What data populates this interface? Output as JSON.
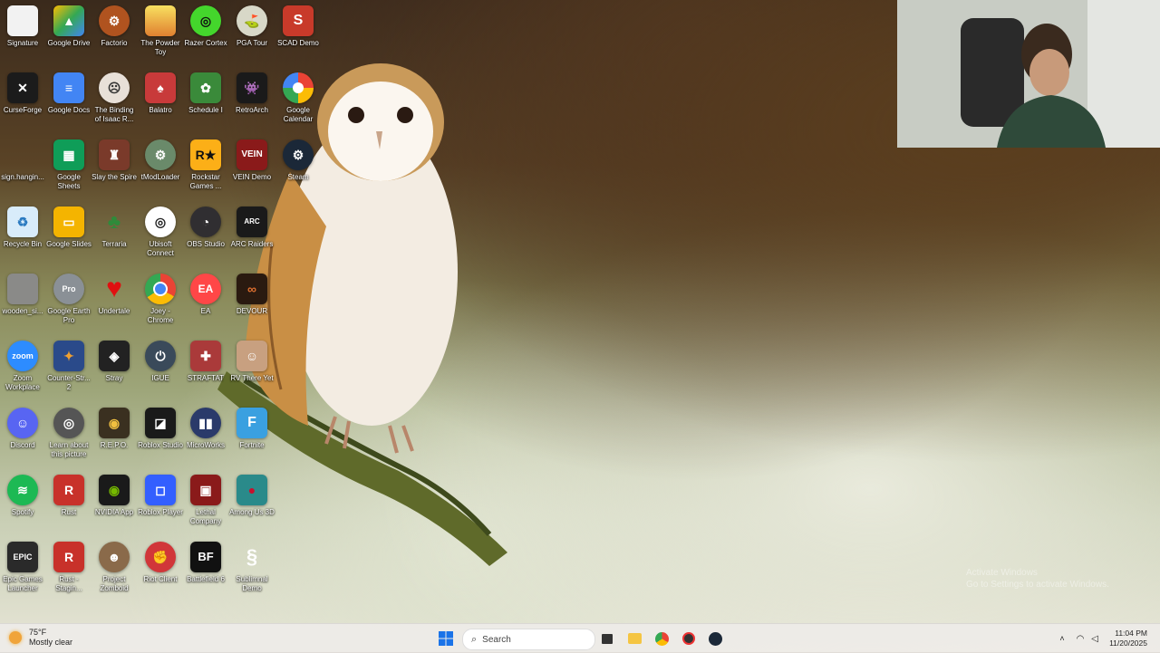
{
  "desktop": {
    "columns": [
      [
        {
          "label": "Signature",
          "icon": "document-icon",
          "color": "#f2f2f2"
        },
        {
          "label": "CurseForge",
          "icon": "curseforge-icon",
          "color": "#1b1b1b"
        },
        {
          "label": "sign.hangin...",
          "icon": "blank-file-icon",
          "color": "#9aa0a0"
        },
        {
          "label": "Recycle Bin",
          "icon": "recycle-bin-icon",
          "color": "#6aa8d8"
        },
        {
          "label": "wooden_si...",
          "icon": "image-file-icon",
          "color": "#8a8a88"
        },
        {
          "label": "Zoom Workplace",
          "icon": "zoom-icon",
          "color": "#2d8cff"
        },
        {
          "label": "Discord",
          "icon": "discord-icon",
          "color": "#5865f2"
        },
        {
          "label": "Spotify",
          "icon": "spotify-icon",
          "color": "#1db954"
        },
        {
          "label": "Epic Games Launcher",
          "icon": "epic-games-icon",
          "color": "#2a2a2a"
        }
      ],
      [
        {
          "label": "Google Drive",
          "icon": "google-drive-icon",
          "color": "#34a853"
        },
        {
          "label": "Google Docs",
          "icon": "google-docs-icon",
          "color": "#4285f4"
        },
        {
          "label": "Google Sheets",
          "icon": "google-sheets-icon",
          "color": "#0f9d58"
        },
        {
          "label": "Google Slides",
          "icon": "google-slides-icon",
          "color": "#f4b400"
        },
        {
          "label": "Google Earth Pro",
          "icon": "google-earth-icon",
          "color": "#8a9096"
        },
        {
          "label": "Counter-Str... 2",
          "icon": "counter-strike-icon",
          "color": "#2a4a8a"
        },
        {
          "label": "Learn about this picture",
          "icon": "camera-icon",
          "color": "#555555"
        },
        {
          "label": "Rust",
          "icon": "rust-icon",
          "color": "#c8312a"
        },
        {
          "label": "Rust - Stagin...",
          "icon": "rust-staging-icon",
          "color": "#c8312a"
        }
      ],
      [
        {
          "label": "Factorio",
          "icon": "factorio-icon",
          "color": "#b0531f"
        },
        {
          "label": "The Binding of Isaac R...",
          "icon": "isaac-icon",
          "color": "#e8e0d8"
        },
        {
          "label": "Slay the Spire",
          "icon": "slay-the-spire-icon",
          "color": "#7a3a2a"
        },
        {
          "label": "Terraria",
          "icon": "terraria-icon",
          "color": "#2e8b3a"
        },
        {
          "label": "Undertale",
          "icon": "undertale-icon",
          "color": "#e01010"
        },
        {
          "label": "Stray",
          "icon": "stray-icon",
          "color": "#222222"
        },
        {
          "label": "R.E.P.O.",
          "icon": "repo-icon",
          "color": "#3a3020"
        },
        {
          "label": "NVIDIA App",
          "icon": "nvidia-icon",
          "color": "#76b900"
        },
        {
          "label": "Project Zomboid",
          "icon": "project-zomboid-icon",
          "color": "#8a6a4a"
        }
      ],
      [
        {
          "label": "The Powder Toy",
          "icon": "powder-toy-icon",
          "color": "#e8c040"
        },
        {
          "label": "Balatro",
          "icon": "balatro-icon",
          "color": "#c83a3a"
        },
        {
          "label": "tModLoader",
          "icon": "tmodloader-icon",
          "color": "#6a8a6a"
        },
        {
          "label": "Ubisoft Connect",
          "icon": "ubisoft-icon",
          "color": "#2a2a2a"
        },
        {
          "label": "Joey - Chrome",
          "icon": "chrome-icon",
          "color": "#4285f4"
        },
        {
          "label": "IGUE",
          "icon": "igue-icon",
          "color": "#3a4a5a"
        },
        {
          "label": "Roblox Studio",
          "icon": "roblox-studio-icon",
          "color": "#1a1a1a"
        },
        {
          "label": "Roblox Player",
          "icon": "roblox-player-icon",
          "color": "#335fff"
        },
        {
          "label": "Riot Client",
          "icon": "riot-client-icon",
          "color": "#d13639"
        }
      ],
      [
        {
          "label": "Razer Cortex",
          "icon": "razer-cortex-icon",
          "color": "#44d62c"
        },
        {
          "label": "Schedule I",
          "icon": "schedule-one-icon",
          "color": "#3a8a3a"
        },
        {
          "label": "Rockstar Games ...",
          "icon": "rockstar-icon",
          "color": "#fcaf17"
        },
        {
          "label": "OBS Studio",
          "icon": "obs-icon",
          "color": "#302e31"
        },
        {
          "label": "EA",
          "icon": "ea-icon",
          "color": "#ff4747"
        },
        {
          "label": "STRAFTAT",
          "icon": "straftat-icon",
          "color": "#aa3a3a"
        },
        {
          "label": "MicroWorks",
          "icon": "microworks-icon",
          "color": "#2a3a6a"
        },
        {
          "label": "Lethal Company",
          "icon": "lethal-company-icon",
          "color": "#8a1a1a"
        },
        {
          "label": "Battlefield 6",
          "icon": "battlefield-icon",
          "color": "#111111"
        }
      ],
      [
        {
          "label": "PGA Tour",
          "icon": "pga-tour-icon",
          "color": "#d8d8c8"
        },
        {
          "label": "RetroArch",
          "icon": "retroarch-icon",
          "color": "#1a1a1a"
        },
        {
          "label": "VEIN Demo",
          "icon": "vein-icon",
          "color": "#8a1a1a"
        },
        {
          "label": "ARC Raiders",
          "icon": "arc-raiders-icon",
          "color": "#1a1a1a"
        },
        {
          "label": "DEVOUR",
          "icon": "devour-icon",
          "color": "#2a1a10"
        },
        {
          "label": "RV There Yet",
          "icon": "rv-there-yet-icon",
          "color": "#c8a080"
        },
        {
          "label": "Fortnite",
          "icon": "fortnite-icon",
          "color": "#3aa0e0"
        },
        {
          "label": "Among Us 3D",
          "icon": "among-us-icon",
          "color": "#c8102e"
        },
        {
          "label": "Sublimnal Demo",
          "icon": "sublimnal-icon",
          "color": "#8a9a6a"
        }
      ],
      [
        {
          "label": "SCAD Demo",
          "icon": "scad-icon",
          "color": "#c83a2a"
        },
        {
          "label": "Google Calendar",
          "icon": "google-calendar-icon",
          "color": "#4285f4"
        },
        {
          "label": "Steam",
          "icon": "steam-icon",
          "color": "#1b2838"
        }
      ]
    ]
  },
  "taskbar": {
    "weather": {
      "temp": "75°F",
      "desc": "Mostly clear"
    },
    "search_placeholder": "Search",
    "clock": {
      "time": "11:04 PM",
      "date": "11/20/2025"
    }
  },
  "watermark": {
    "line1": "Activate Windows",
    "line2": "Go to Settings to activate Windows."
  }
}
